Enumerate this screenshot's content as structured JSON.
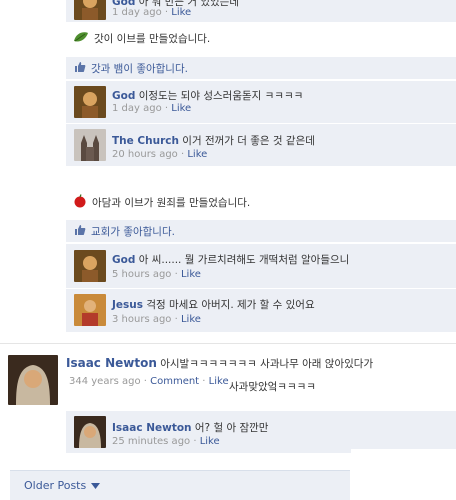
{
  "top_comment": {
    "author": "God",
    "text": "아 뭐 만든 거 있었는데",
    "time": "1 day ago",
    "like": "Like"
  },
  "post1": {
    "text": "갓이 이브를 만들었습니다.",
    "likes": "갓과 뱀이 좋아합니다.",
    "comments": [
      {
        "author": "God",
        "text": "이정도는 되야 성스러움돋지 ㅋㅋㅋㅋ",
        "time": "1 day ago",
        "like": "Like"
      },
      {
        "author": "The Church",
        "text": "이거 전꺼가 더 좋은 것 같은데",
        "time": "20 hours ago",
        "like": "Like"
      }
    ]
  },
  "post2": {
    "text": "아담과 이브가 원죄를 만들었습니다.",
    "likes": "교회가 좋아합니다.",
    "comments": [
      {
        "author": "God",
        "text": "아 씨...... 뭘 가르치려해도 개떡처럼 알아들으니",
        "time": "5 hours ago",
        "like": "Like"
      },
      {
        "author": "Jesus",
        "text": "걱정 마세요 아버지. 제가 할 수 있어요",
        "time": "3 hours ago",
        "like": "Like"
      }
    ]
  },
  "newton_post": {
    "author": "Isaac Newton",
    "text": "아시발ㅋㅋㅋㅋㅋㅋㅋ 사과나무 아래 앉아있다가",
    "text2": "사과맞았엌ㅋㅋㅋㅋ",
    "time": "344 years ago",
    "comment": "Comment",
    "like": "Like",
    "reply": {
      "author": "Isaac Newton",
      "text": "어? 헐 아 잠깐만",
      "time": "25 minutes ago",
      "like": "Like"
    }
  },
  "footer": {
    "older_posts": "Older Posts"
  },
  "colors": {
    "link": "#3b5998",
    "comment_bg": "#eceff5"
  }
}
